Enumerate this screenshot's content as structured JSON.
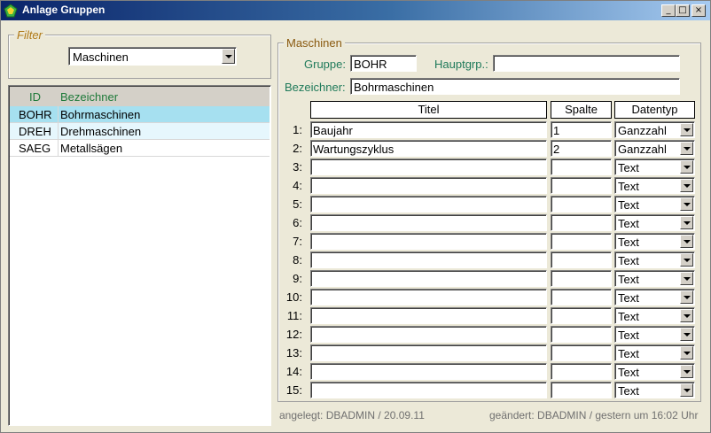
{
  "window": {
    "title": "Anlage Gruppen",
    "controls": {
      "minimize": "_",
      "maximize": "□",
      "close": "×"
    }
  },
  "filter": {
    "legend": "Filter",
    "selected": "Maschinen"
  },
  "list": {
    "columns": [
      "ID",
      "Bezeichner"
    ],
    "rows": [
      {
        "id": "BOHR",
        "name": "Bohrmaschinen",
        "selected": true
      },
      {
        "id": "DREH",
        "name": "Drehmaschinen",
        "selected": false
      },
      {
        "id": "SAEG",
        "name": "Metallsägen",
        "selected": false
      }
    ]
  },
  "detail": {
    "legend": "Maschinen",
    "gruppe_label": "Gruppe:",
    "gruppe_value": "BOHR",
    "hauptgrp_label": "Hauptgrp.:",
    "hauptgrp_value": "",
    "bezeichner_label": "Bezeichner:",
    "bezeichner_value": "Bohrmaschinen"
  },
  "grid": {
    "headers": {
      "titel": "Titel",
      "spalte": "Spalte",
      "datentyp": "Datentyp"
    },
    "rows": [
      {
        "num": "1:",
        "titel": "Baujahr",
        "spalte": "1",
        "datentyp": "Ganzzahl"
      },
      {
        "num": "2:",
        "titel": "Wartungszyklus",
        "spalte": "2",
        "datentyp": "Ganzzahl"
      },
      {
        "num": "3:",
        "titel": "",
        "spalte": "",
        "datentyp": "Text"
      },
      {
        "num": "4:",
        "titel": "",
        "spalte": "",
        "datentyp": "Text"
      },
      {
        "num": "5:",
        "titel": "",
        "spalte": "",
        "datentyp": "Text"
      },
      {
        "num": "6:",
        "titel": "",
        "spalte": "",
        "datentyp": "Text"
      },
      {
        "num": "7:",
        "titel": "",
        "spalte": "",
        "datentyp": "Text"
      },
      {
        "num": "8:",
        "titel": "",
        "spalte": "",
        "datentyp": "Text"
      },
      {
        "num": "9:",
        "titel": "",
        "spalte": "",
        "datentyp": "Text"
      },
      {
        "num": "10:",
        "titel": "",
        "spalte": "",
        "datentyp": "Text"
      },
      {
        "num": "11:",
        "titel": "",
        "spalte": "",
        "datentyp": "Text"
      },
      {
        "num": "12:",
        "titel": "",
        "spalte": "",
        "datentyp": "Text"
      },
      {
        "num": "13:",
        "titel": "",
        "spalte": "",
        "datentyp": "Text"
      },
      {
        "num": "14:",
        "titel": "",
        "spalte": "",
        "datentyp": "Text"
      },
      {
        "num": "15:",
        "titel": "",
        "spalte": "",
        "datentyp": "Text"
      }
    ]
  },
  "footer": {
    "created": "angelegt: DBADMIN / 20.09.11",
    "modified": "geändert: DBADMIN / gestern um 16:02 Uhr"
  },
  "colors": {
    "title_gradient_start": "#0a246a",
    "label_green": "#1f7a5a",
    "selected_row": "#a6e0f0",
    "legend_brown": "#b07a18"
  }
}
